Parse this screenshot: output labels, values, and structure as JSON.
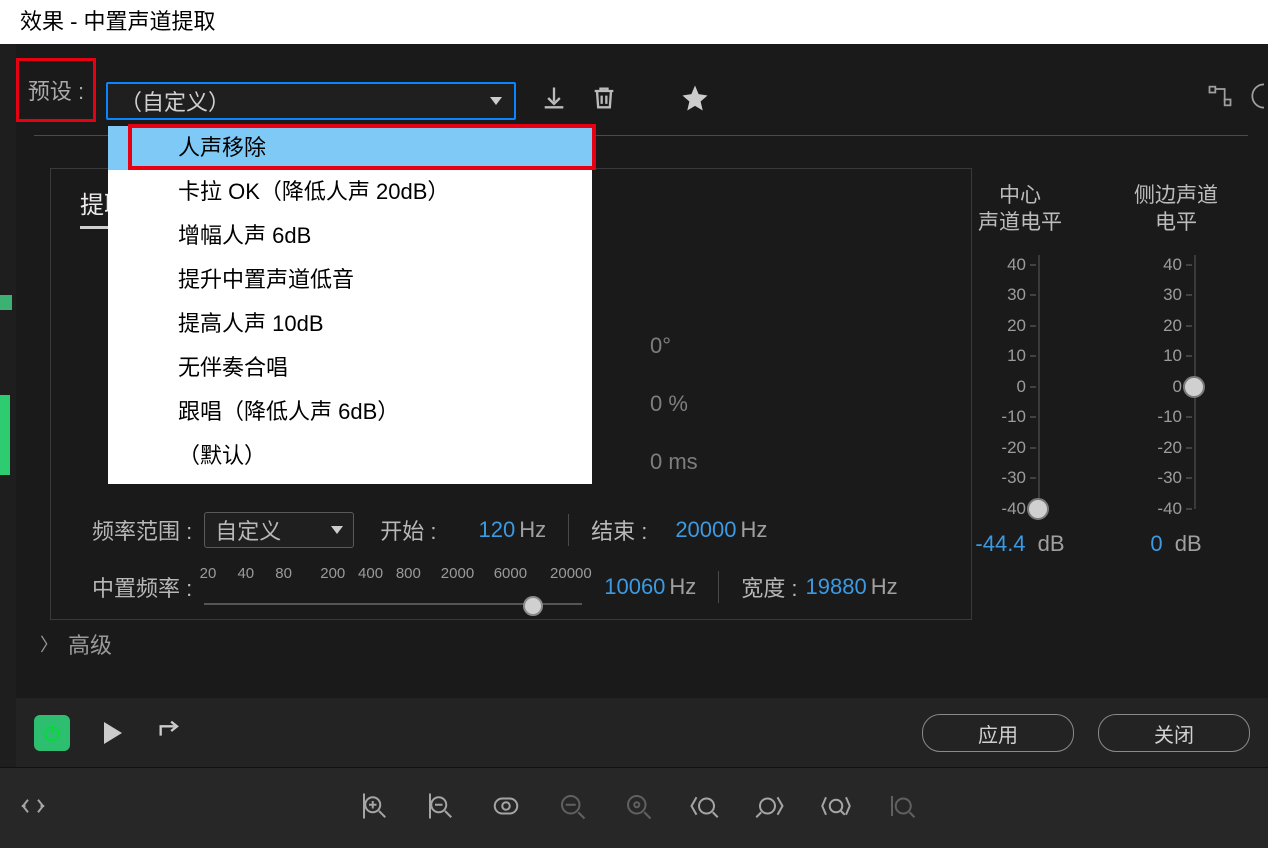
{
  "window": {
    "title": "效果 - 中置声道提取"
  },
  "preset": {
    "label": "预设 :",
    "selected": "（自定义）",
    "options": [
      "人声移除",
      "卡拉 OK（降低人声 20dB）",
      "增幅人声 6dB",
      "提升中置声道低音",
      "提高人声 10dB",
      "无伴奏合唱",
      "跟唱（降低人声 6dB）",
      "（默认）"
    ]
  },
  "tabs": {
    "extract": "提取"
  },
  "background_values": {
    "angle": "0°",
    "percent": "0 %",
    "delay": "0 ms"
  },
  "frequency": {
    "range_label": "频率范围 :",
    "range_value": "自定义",
    "start_label": "开始 :",
    "start_value": "120",
    "start_unit": "Hz",
    "end_label": "结束 :",
    "end_value": "20000",
    "end_unit": "Hz"
  },
  "center_freq": {
    "label": "中置频率 :",
    "ticks": [
      "20",
      "40",
      "80",
      "200",
      "400",
      "800",
      "2000",
      "6000",
      "20000"
    ],
    "value": "10060",
    "unit": "Hz",
    "width_label": "宽度 :",
    "width_value": "19880",
    "width_unit": "Hz"
  },
  "advanced": {
    "label": "高级"
  },
  "meters": {
    "center": {
      "title": "中心\n声道电平",
      "ticks": [
        "40",
        "30",
        "20",
        "10",
        "0",
        "-10",
        "-20",
        "-30",
        "-40"
      ],
      "value": "-44.4",
      "unit": "dB"
    },
    "side": {
      "title": "侧边声道\n电平",
      "ticks": [
        "40",
        "30",
        "20",
        "10",
        "0",
        "-10",
        "-20",
        "-30",
        "-40"
      ],
      "value": "0",
      "unit": "dB"
    }
  },
  "buttons": {
    "apply": "应用",
    "close": "关闭"
  }
}
